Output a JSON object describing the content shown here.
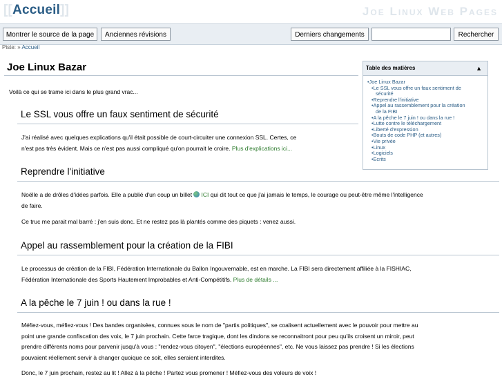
{
  "header": {
    "logo_open": "[[",
    "logo_text": "Accueil",
    "logo_close": "]]",
    "site_name": "Joe Linux Web Pages"
  },
  "toolbar": {
    "show_source": "Montrer le source de la page",
    "old_revisions": "Anciennes révisions",
    "recent_changes": "Derniers changements",
    "search_value": "",
    "search_button": "Rechercher"
  },
  "breadcrumb": {
    "label": "Piste: »",
    "item": "Accueil"
  },
  "page": {
    "title": "Joe Linux Bazar",
    "intro": "Voilà ce qui se trame ici dans le plus grand vrac..."
  },
  "toc": {
    "title": "Table des matières",
    "toggle": "▲",
    "items": [
      "•Joe Linux Bazar",
      "•Le SSL vous offre un faux sentiment de",
      "sécurité",
      "•Reprendre l'initiative",
      "•Appel au rassemblement pour la création",
      "de la FIBI",
      "•A la pêche le 7 juin ! ou dans la rue !",
      "•Lutte contre le téléchargement",
      "•Liberté d'expression",
      "•Bouts de code PHP (et autres)",
      "•Vie privée",
      "•Linux",
      "•Logiciels",
      "•Ecrits"
    ]
  },
  "sections": [
    {
      "heading": "Le SSL vous offre un faux sentiment de sécurité",
      "p1_line1": "J'ai réalisé avec quelques explications qu'il était possible de court-circuiter une connexion SSL. Certes, ce",
      "p1_line2": "n'est pas très évident. Mais ce n'est pas aussi compliqué qu'on pourrait le croire.",
      "p1_link": "Plus d'explications ici..."
    },
    {
      "heading": "Reprendre l'initiative",
      "p1_pre": "Noëlle a de drôles d'idées parfois. Elle a publié d'un coup un billet",
      "p1_link": "ICI",
      "p1_post": "qui dit tout ce que j'ai jamais le temps, le courage ou peut-être même l'intelligence",
      "p1_line2": "de faire.",
      "p2": "Ce truc me parait mal barré : j'en suis donc. Et ne restez pas là plantés comme des piquets : venez aussi."
    },
    {
      "heading": "Appel au rassemblement pour la création de la FIBI",
      "p1_line1": "Le processus de création de la FIBI, Fédération Internationale du Ballon Ingouvernable, est en marche. La FIBI sera directement affiliée à la FISHIAC,",
      "p1_line2": "Fédération Internationale des Sports Hautement Improbables et Anti-Compétitifs.",
      "p1_link": "Plus de détails ..."
    },
    {
      "heading": "A la pêche le 7 juin ! ou dans la rue !",
      "p1_line1": "Méfiez-vous, méfiez-vous ! Des bandes organisées, connues sous le nom de \"partis politiques\", se coalisent actuellement avec le pouvoir pour mettre au",
      "p1_line2": "point une grande confiscation des voix, le 7 juin prochain. Cette farce tragique, dont les dindons se reconnaitront pour peu qu'ils croisent un miroir, peut",
      "p1_line3": "prendre différents noms pour parvenir jusqu'à vous : \"rendez-vous citoyen\", \"élections européennes\", etc. Ne vous laissez pas prendre ! Si les élections",
      "p1_line4": "pouvaient réellement servir à changer quoique ce soit, elles seraient interdites.",
      "p2": "Donc, le 7 juin prochain, restez au lit ! Allez à la pêche ! Partez vous promener ! Méfiez-vous des voleurs de voix !"
    }
  ]
}
